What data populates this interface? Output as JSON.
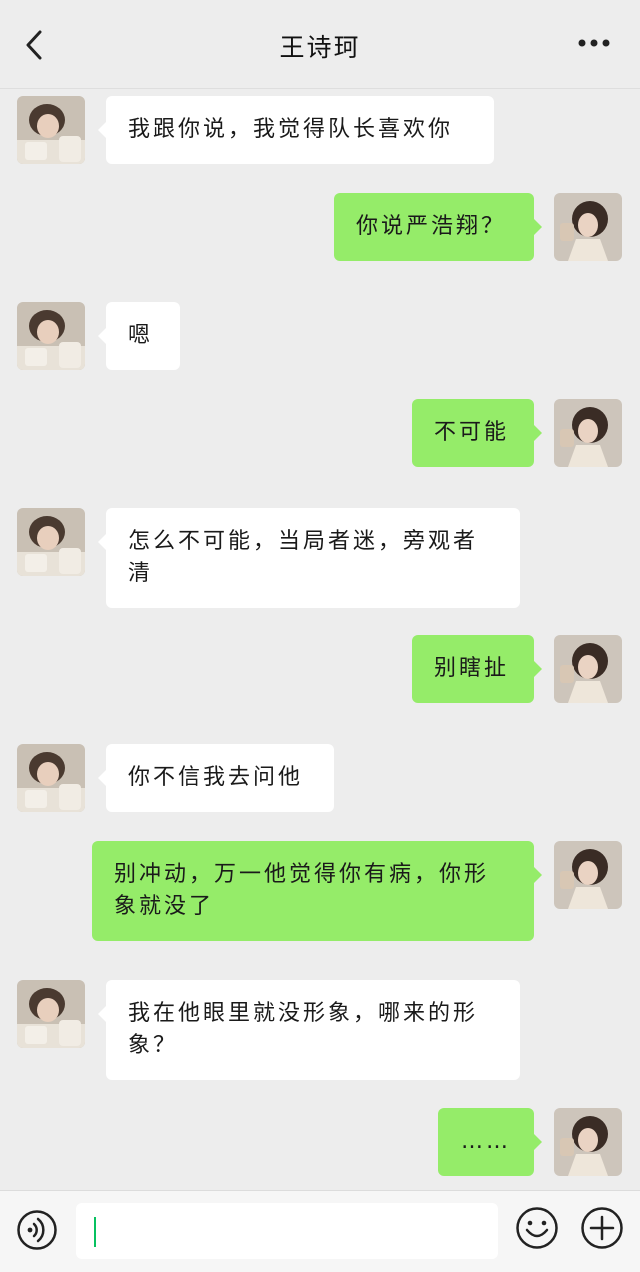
{
  "header": {
    "title": "王诗珂",
    "back_icon": "chevron-left-icon",
    "more_icon": "more-dots-icon"
  },
  "colors": {
    "background": "#ededed",
    "incoming_bubble": "#ffffff",
    "outgoing_bubble": "#95ec69",
    "cursor": "#07c160"
  },
  "messages": [
    {
      "side": "in",
      "text": "我跟你说，我觉得队长喜欢你"
    },
    {
      "side": "out",
      "text": "你说严浩翔？"
    },
    {
      "side": "in",
      "text": "嗯"
    },
    {
      "side": "out",
      "text": "不可能"
    },
    {
      "side": "in",
      "text": "怎么不可能，当局者迷，旁观者清"
    },
    {
      "side": "out",
      "text": "别瞎扯"
    },
    {
      "side": "in",
      "text": "你不信我去问他"
    },
    {
      "side": "out",
      "text": "别冲动，万一他觉得你有病，你形象就没了"
    },
    {
      "side": "in",
      "text": "我在他眼里就没形象，哪来的形象？"
    },
    {
      "side": "out",
      "text": "……"
    }
  ],
  "input": {
    "value": "",
    "voice_icon": "voice-icon",
    "emoji_icon": "emoji-icon",
    "plus_icon": "plus-icon"
  }
}
